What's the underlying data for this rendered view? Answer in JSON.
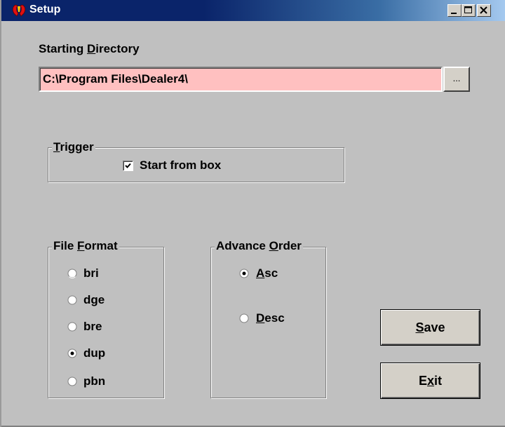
{
  "window": {
    "title": "Setup",
    "controls": {
      "minimize": "minimize-icon",
      "maximize": "maximize-icon",
      "close": "close-icon"
    }
  },
  "starting_directory": {
    "label": "Starting Directory",
    "mnemonic": "D",
    "value": "C:\\Program Files\\Dealer4\\",
    "browse_label": "...",
    "field_color": "#ffc0c0"
  },
  "trigger": {
    "legend": "Trigger",
    "mnemonic": "T",
    "start_from_box": {
      "label": "Start from box",
      "checked": true
    }
  },
  "file_format": {
    "legend": "File Format",
    "mnemonic": "F",
    "options": [
      {
        "label": "bri",
        "selected": false
      },
      {
        "label": "dge",
        "selected": false
      },
      {
        "label": "bre",
        "selected": false
      },
      {
        "label": "dup",
        "selected": true
      },
      {
        "label": "pbn",
        "selected": false
      }
    ]
  },
  "advance_order": {
    "legend": "Advance Order",
    "mnemonic": "O",
    "options": [
      {
        "label": "Asc",
        "mnemonic": "A",
        "selected": true
      },
      {
        "label": "Desc",
        "mnemonic": "D",
        "selected": false
      }
    ]
  },
  "buttons": {
    "save": {
      "label": "Save",
      "mnemonic": "S"
    },
    "exit": {
      "label": "Exit",
      "mnemonic": "x"
    }
  }
}
